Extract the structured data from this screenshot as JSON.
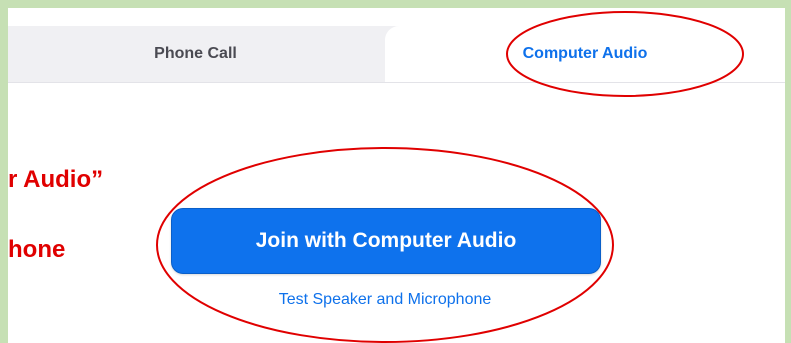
{
  "tabs": {
    "phone_call": "Phone Call",
    "computer_audio": "Computer Audio",
    "active": "computer_audio"
  },
  "side_annotations": {
    "line1": "r Audio”",
    "line2": "hone"
  },
  "main": {
    "join_button": "Join with Computer Audio",
    "test_link": "Test Speaker and Microphone"
  },
  "colors": {
    "accent_blue": "#0e72ed",
    "annotation_red": "#e00000",
    "frame_green": "#c6e0b4"
  }
}
